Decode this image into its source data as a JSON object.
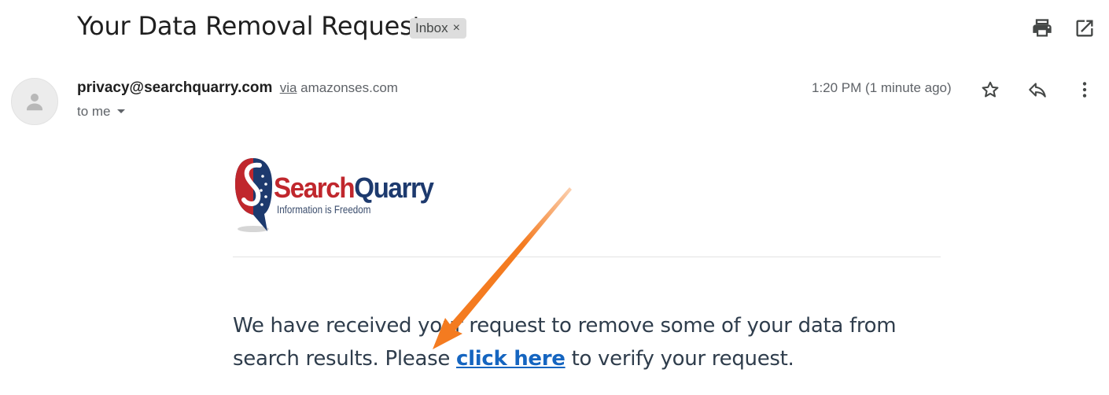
{
  "email": {
    "subject": "Your Data Removal Request",
    "label_chip": "Inbox",
    "chip_remove": "×",
    "sender_email": "privacy@searchquarry.com",
    "via_word": "via",
    "via_domain": "amazonses.com",
    "to_text": "to me",
    "time": "1:20 PM (1 minute ago)"
  },
  "logo": {
    "brand_part1": "Search",
    "brand_part2": "Quarry",
    "tagline": "Information is Freedom"
  },
  "message": {
    "text_before": "We have received your request to remove some of your data from search results. Please ",
    "link_text": "click here",
    "text_after": " to verify your request."
  },
  "icons": {
    "print": "print-icon",
    "open_new_window": "open-in-new-window-icon",
    "star": "star-icon",
    "reply": "reply-icon",
    "more": "more-vert-icon",
    "avatar": "person-icon",
    "dropdown": "caret-down-icon",
    "annotation_arrow": "arrow-annotation"
  },
  "colors": {
    "link": "#1565c0",
    "arrow": "#f47b20",
    "brand_red": "#c0272d",
    "brand_navy": "#1d3a6e"
  }
}
